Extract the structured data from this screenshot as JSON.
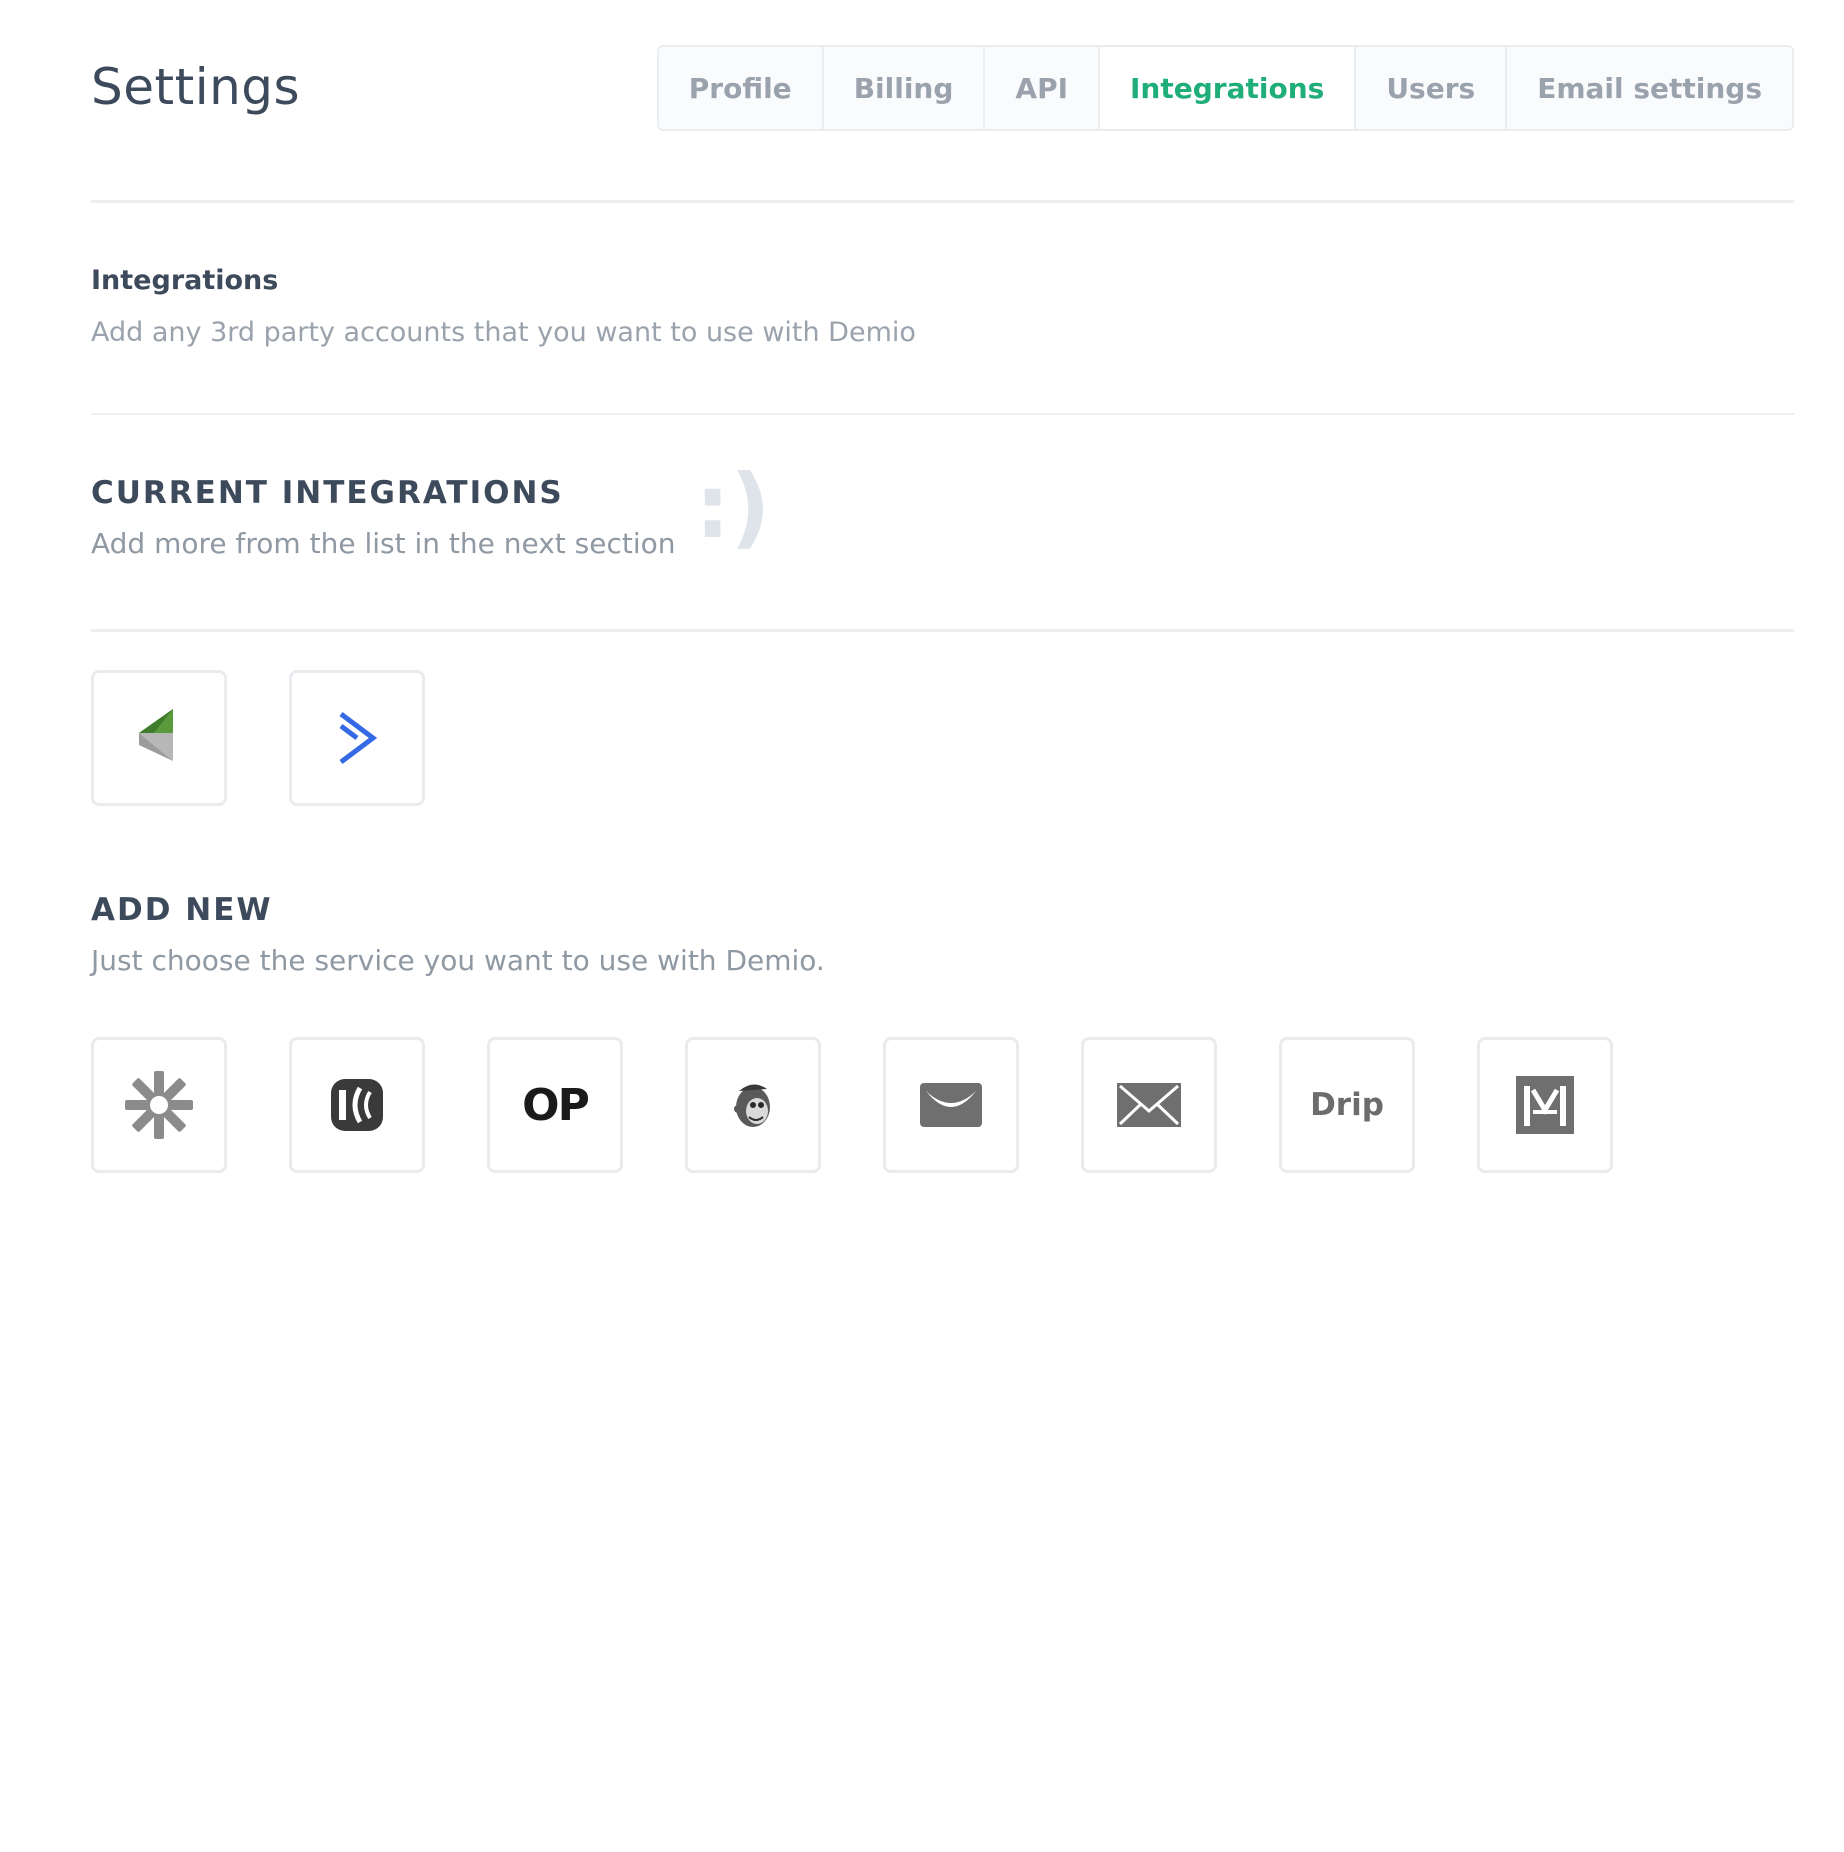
{
  "header": {
    "title": "Settings",
    "tabs": [
      {
        "label": "Profile",
        "active": false
      },
      {
        "label": "Billing",
        "active": false
      },
      {
        "label": "API",
        "active": false
      },
      {
        "label": "Integrations",
        "active": true
      },
      {
        "label": "Users",
        "active": false
      },
      {
        "label": "Email settings",
        "active": false
      }
    ]
  },
  "intro": {
    "title": "Integrations",
    "subtitle": "Add any 3rd party accounts that you want to use with Demio"
  },
  "current": {
    "title": "CURRENT INTEGRATIONS",
    "subtitle": "Add more from the list in the next section",
    "smiley": ":)",
    "items": [
      {
        "icon": "infusionsoft-icon"
      },
      {
        "icon": "activecampaign-icon"
      }
    ]
  },
  "add_new": {
    "title": "ADD NEW",
    "subtitle": "Just choose the service you want to use with Demio.",
    "items": [
      {
        "icon": "zapier-icon"
      },
      {
        "icon": "convertkit-icon"
      },
      {
        "icon": "ontraport-icon",
        "text": "OP"
      },
      {
        "icon": "mailchimp-icon"
      },
      {
        "icon": "getresponse-icon"
      },
      {
        "icon": "email-icon"
      },
      {
        "icon": "drip-icon",
        "text": "Drip"
      },
      {
        "icon": "maropost-icon"
      }
    ]
  },
  "colors": {
    "accent": "#1fae7a",
    "text": "#3d4a5c",
    "muted": "#9aa3ad",
    "border": "#e9ecef"
  }
}
